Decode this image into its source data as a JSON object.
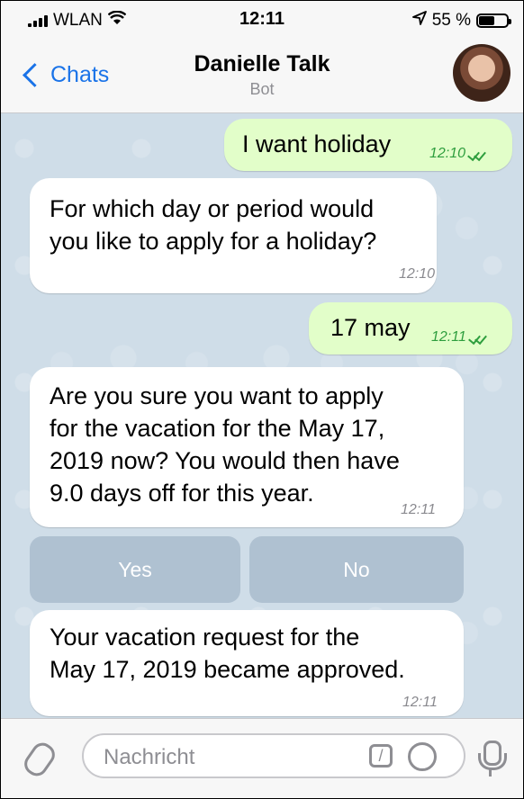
{
  "status_bar": {
    "carrier": "WLAN",
    "time": "12:11",
    "battery_percent": "55 %",
    "battery_level": 0.55
  },
  "header": {
    "back_label": "Chats",
    "title": "Danielle Talk",
    "subtitle": "Bot"
  },
  "messages": [
    {
      "direction": "out",
      "text": "I want holiday",
      "time": "12:10",
      "status": "read"
    },
    {
      "direction": "in",
      "text": "For which day or period would\nyou like to apply for a holiday?",
      "time": "12:10"
    },
    {
      "direction": "out",
      "text": "17 may",
      "time": "12:11",
      "status": "read"
    },
    {
      "direction": "in",
      "text": "Are you sure you want to apply\nfor the vacation for the May 17,\n2019 now? You would then have\n9.0 days off for this year.",
      "time": "12:11"
    },
    {
      "direction": "in",
      "text": "Your vacation request for the\nMay 17, 2019 became approved.",
      "time": "12:11"
    }
  ],
  "keyboard_buttons": [
    "Yes",
    "No"
  ],
  "composer": {
    "placeholder": "Nachricht"
  },
  "colors": {
    "accent": "#1a73e8",
    "outgoing_bubble": "#e2fec9",
    "incoming_bubble": "#ffffff",
    "chat_background": "#cfdde8"
  },
  "icons": [
    "wifi-icon",
    "location-arrow-icon",
    "battery-icon",
    "chevron-left-icon",
    "paperclip-icon",
    "slash-command-icon",
    "sticker-icon",
    "microphone-icon"
  ]
}
